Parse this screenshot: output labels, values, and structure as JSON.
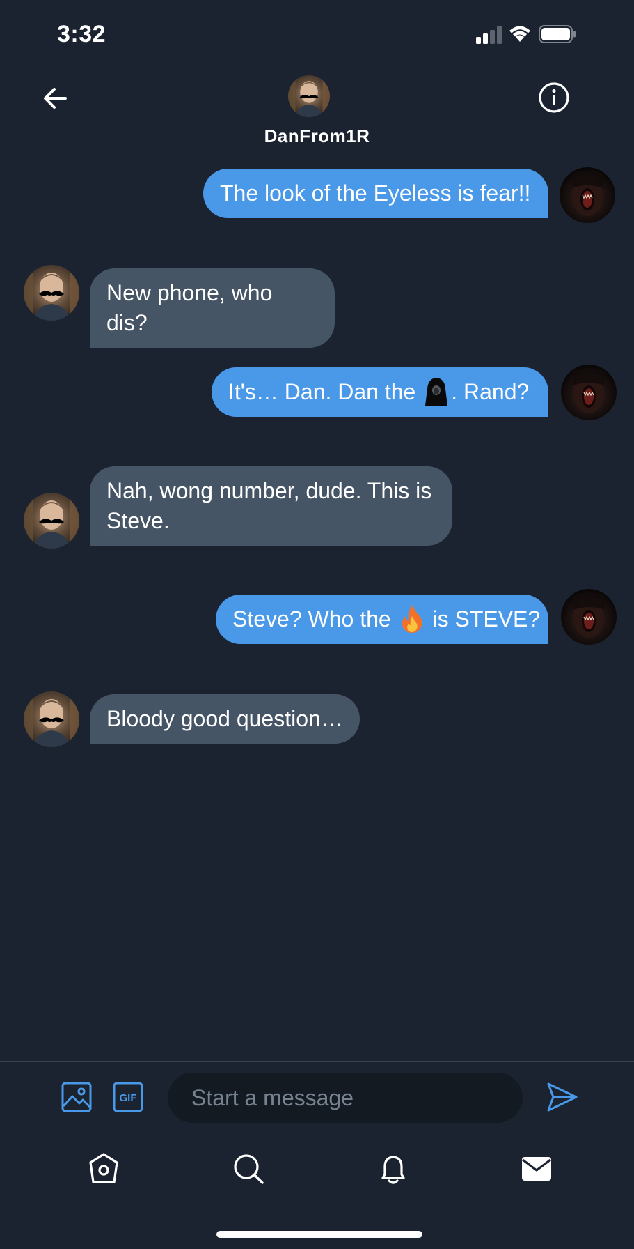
{
  "status_bar": {
    "time": "3:32"
  },
  "header": {
    "name": "DanFrom1R"
  },
  "messages": [
    {
      "direction": "out",
      "text": "The look of the Eyeless is fear!!"
    },
    {
      "direction": "in",
      "text": "New phone, who dis?"
    },
    {
      "direction": "out",
      "text_before": "It's… Dan. Dan the",
      "emoji": "hooded-figure",
      "text_after": ". Rand?"
    },
    {
      "direction": "in",
      "line1": "Nah, wong number, dude. This is",
      "line2": "Steve."
    },
    {
      "direction": "out",
      "text_before": "Steve? Who the",
      "emoji": "fire",
      "text_after": "is STEVE?"
    },
    {
      "direction": "in",
      "text": "Bloody good question…"
    }
  ],
  "composer": {
    "placeholder": "Start a message"
  },
  "colors": {
    "background": "#1b2330",
    "outgoing_bubble": "#4a99e9",
    "incoming_bubble": "#465566",
    "accent": "#4a99e9"
  },
  "icons": {
    "back": "arrow-left-icon",
    "info": "info-icon",
    "image": "image-icon",
    "gif": "gif-icon",
    "send": "send-icon",
    "home": "home-icon",
    "search": "search-icon",
    "notifications": "bell-icon",
    "messages": "mail-icon"
  }
}
